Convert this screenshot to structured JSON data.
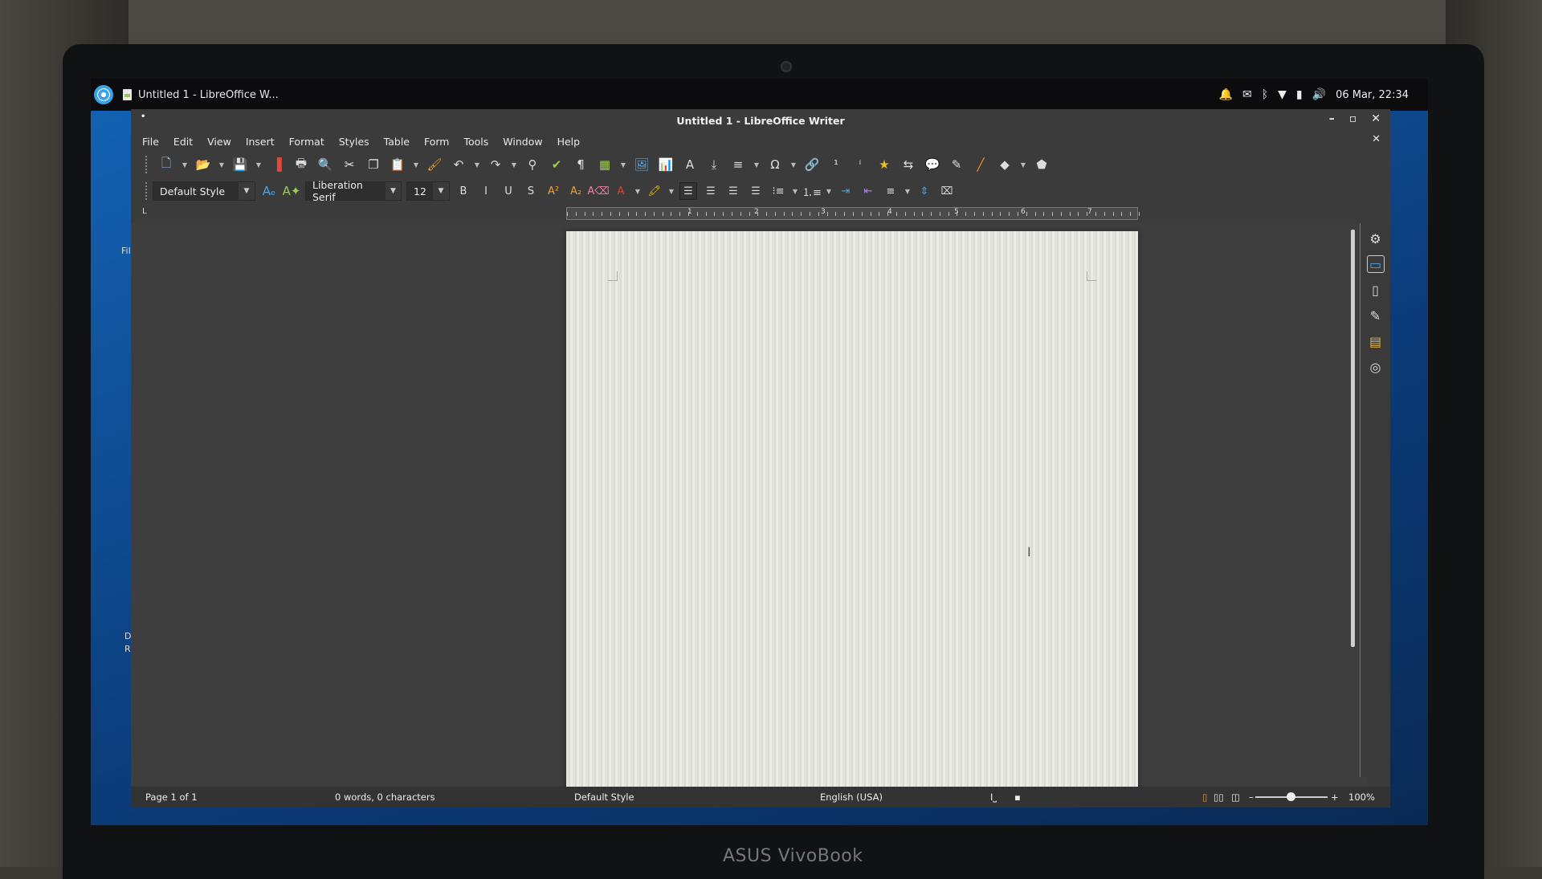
{
  "device": {
    "brand": "ASUS VivoBook"
  },
  "top_panel": {
    "task_title": "Untitled 1 - LibreOffice W...",
    "tray_icons": [
      "bell-icon",
      "mail-icon",
      "bluetooth-icon",
      "wifi-icon",
      "battery-icon",
      "volume-icon"
    ],
    "clock": "06 Mar, 22:34"
  },
  "window": {
    "title": "Untitled 1 - LibreOffice Writer",
    "controls": {
      "minimize": "–",
      "maximize": "▫",
      "close": "✕",
      "close_document": "✕"
    }
  },
  "menubar": {
    "items": [
      "File",
      "Edit",
      "View",
      "Insert",
      "Format",
      "Styles",
      "Table",
      "Form",
      "Tools",
      "Window",
      "Help"
    ]
  },
  "left_edge_label": "File",
  "standard_toolbar": [
    {
      "name": "new-document",
      "glyph": "🗋",
      "dropdown": true
    },
    {
      "name": "open",
      "glyph": "📂",
      "dropdown": true
    },
    {
      "name": "save",
      "glyph": "💾",
      "dropdown": true
    },
    {
      "name": "export-pdf",
      "glyph": "▐"
    },
    {
      "name": "print",
      "glyph": "🖶"
    },
    {
      "name": "print-preview",
      "glyph": "🔍"
    },
    {
      "name": "cut",
      "glyph": "✂"
    },
    {
      "name": "copy",
      "glyph": "❐"
    },
    {
      "name": "paste",
      "glyph": "📋",
      "dropdown": true
    },
    {
      "name": "clone-formatting",
      "glyph": "🖌"
    },
    {
      "name": "undo",
      "glyph": "↶",
      "dropdown": true
    },
    {
      "name": "redo",
      "glyph": "↷",
      "dropdown": true
    },
    {
      "name": "find-replace",
      "glyph": "⚲"
    },
    {
      "name": "spelling",
      "glyph": "✔"
    },
    {
      "name": "formatting-marks",
      "glyph": "¶"
    },
    {
      "name": "insert-table",
      "glyph": "▦",
      "dropdown": true
    },
    {
      "name": "insert-image",
      "glyph": "🖼"
    },
    {
      "name": "insert-chart",
      "glyph": "📊"
    },
    {
      "name": "insert-text-box",
      "glyph": "A"
    },
    {
      "name": "insert-page-break",
      "glyph": "⤓"
    },
    {
      "name": "insert-field",
      "glyph": "≡",
      "dropdown": true
    },
    {
      "name": "insert-special-character",
      "glyph": "Ω",
      "dropdown": true
    },
    {
      "name": "insert-hyperlink",
      "glyph": "🔗"
    },
    {
      "name": "insert-footnote",
      "glyph": "¹"
    },
    {
      "name": "insert-endnote",
      "glyph": "ⁱ"
    },
    {
      "name": "insert-bookmark",
      "glyph": "★"
    },
    {
      "name": "insert-cross-reference",
      "glyph": "⇆"
    },
    {
      "name": "insert-comment",
      "glyph": "💬"
    },
    {
      "name": "track-changes",
      "glyph": "✎"
    },
    {
      "name": "insert-line",
      "glyph": "╱"
    },
    {
      "name": "basic-shapes",
      "glyph": "◆",
      "dropdown": true
    },
    {
      "name": "draw-functions",
      "glyph": "⬟"
    }
  ],
  "formatting_toolbar": {
    "paragraph_style": "Default Style",
    "font_name": "Liberation Serif",
    "font_size": "12",
    "buttons": [
      {
        "name": "update-style",
        "glyph": "Aₑ"
      },
      {
        "name": "new-style",
        "glyph": "A✦"
      },
      {
        "name": "bold",
        "glyph": "B"
      },
      {
        "name": "italic",
        "glyph": "I"
      },
      {
        "name": "underline",
        "glyph": "U"
      },
      {
        "name": "strikethrough",
        "glyph": "S"
      },
      {
        "name": "superscript",
        "glyph": "A²"
      },
      {
        "name": "subscript",
        "glyph": "A₂"
      },
      {
        "name": "clear-formatting",
        "glyph": "A⌫"
      },
      {
        "name": "font-color",
        "glyph": "A",
        "dropdown": true
      },
      {
        "name": "highlight-color",
        "glyph": "🖍",
        "dropdown": true
      },
      {
        "name": "align-left",
        "glyph": "☰",
        "active": true
      },
      {
        "name": "align-center",
        "glyph": "☰"
      },
      {
        "name": "align-right",
        "glyph": "☰"
      },
      {
        "name": "justify",
        "glyph": "☰"
      },
      {
        "name": "unordered-list",
        "glyph": "⁝≡",
        "dropdown": true
      },
      {
        "name": "ordered-list",
        "glyph": "⒈≡",
        "dropdown": true
      },
      {
        "name": "increase-indent",
        "glyph": "⇥"
      },
      {
        "name": "decrease-indent",
        "glyph": "⇤"
      },
      {
        "name": "line-spacing",
        "glyph": "≡",
        "dropdown": true
      },
      {
        "name": "paragraph-spacing",
        "glyph": "⇕"
      },
      {
        "name": "paragraph-dialog",
        "glyph": "⌧"
      }
    ]
  },
  "ruler": {
    "labels": [
      "1",
      "2",
      "3",
      "4",
      "5",
      "6",
      "7"
    ]
  },
  "sidebar": {
    "icons": [
      "gear-icon",
      "properties-icon",
      "page-icon",
      "styles-icon",
      "gallery-icon",
      "navigator-icon"
    ]
  },
  "statusbar": {
    "page": "Page 1 of 1",
    "word_count": "0 words, 0 characters",
    "page_style": "Default Style",
    "language": "English (USA)",
    "insert_mode": "I⎵",
    "signature": "▪",
    "zoom_percent": "100%",
    "zoom_minus": "–",
    "zoom_plus": "+",
    "zoom_level": 1.0
  },
  "left_fragments": [
    "D",
    "R"
  ]
}
